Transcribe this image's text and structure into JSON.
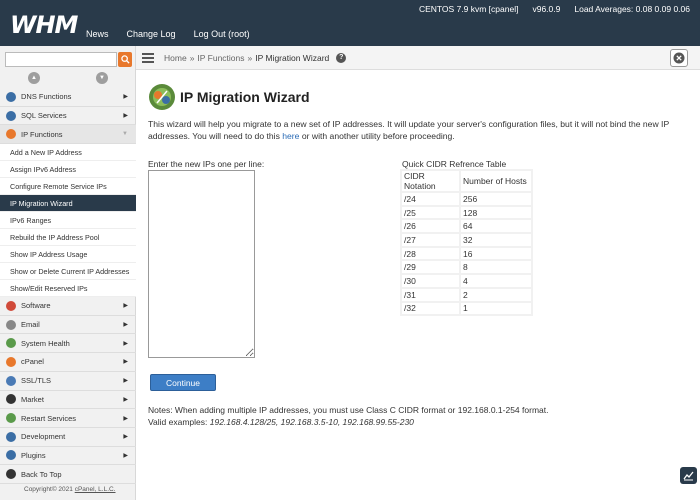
{
  "app": {
    "logo": "WHM"
  },
  "topnav": {
    "items": [
      "News",
      "Change Log",
      "Log Out (root)"
    ]
  },
  "sysinfo": {
    "os": "CENTOS 7.9 kvm [cpanel]",
    "version": "v96.0.9",
    "load": "Load Averages: 0.08 0.09 0.06"
  },
  "search": {
    "value": "",
    "placeholder": ""
  },
  "sidebar": {
    "categories_top": [
      {
        "label": "DNS Functions",
        "icon_color": "#3b6ea5"
      },
      {
        "label": "SQL Services",
        "icon_color": "#3b6ea5"
      },
      {
        "label": "IP Functions",
        "icon_color": "#e8782c"
      }
    ],
    "sub_items": [
      "Add a New IP Address",
      "Assign IPv6 Address",
      "Configure Remote Service IPs",
      "IP Migration Wizard",
      "IPv6 Ranges",
      "Rebuild the IP Address Pool",
      "Show IP Address Usage",
      "Show or Delete Current IP Addresses",
      "Show/Edit Reserved IPs"
    ],
    "active_sub": "IP Migration Wizard",
    "categories_bottom": [
      {
        "label": "Software",
        "icon_color": "#d04a3a"
      },
      {
        "label": "Email",
        "icon_color": "#888888"
      },
      {
        "label": "System Health",
        "icon_color": "#5a9a4a"
      },
      {
        "label": "cPanel",
        "icon_color": "#e8782c"
      },
      {
        "label": "SSL/TLS",
        "icon_color": "#4a7ab5"
      },
      {
        "label": "Market",
        "icon_color": "#333333"
      },
      {
        "label": "Restart Services",
        "icon_color": "#5a9a4a"
      },
      {
        "label": "Development",
        "icon_color": "#3b6ea5"
      },
      {
        "label": "Plugins",
        "icon_color": "#3b6ea5"
      },
      {
        "label": "Back To Top",
        "icon_color": "#333333"
      }
    ],
    "copyright_prefix": "Copyright© 2021 ",
    "copyright_link": "cPanel, L.L.C."
  },
  "breadcrumb": {
    "home": "Home",
    "sep": "»",
    "section": "IP Functions",
    "current": "IP Migration Wizard"
  },
  "main": {
    "title": "IP Migration Wizard",
    "intro_before": "This wizard will help you migrate to a new set of IP addresses. It will update your server's configuration files, but it will not bind the new IP addresses. You will need to do this ",
    "intro_link": "here",
    "intro_after": " or with another utility before proceeding.",
    "ips_label": "Enter the new IPs one per line:",
    "ips_value": "",
    "continue_label": "Continue",
    "notes_line1": "Notes: When adding multiple IP addresses, you must use Class C CIDR format or 192.168.0.1-254 format.",
    "valid_prefix": "Valid examples: ",
    "valid_examples": "192.168.4.128/25, 192.168.3.5-10, 192.168.99.55-230"
  },
  "cidr": {
    "title": "Quick CIDR Refrence Table",
    "headers": [
      "CIDR Notation",
      "Number of Hosts"
    ],
    "rows": [
      [
        "/24",
        "256"
      ],
      [
        "/25",
        "128"
      ],
      [
        "/26",
        "64"
      ],
      [
        "/27",
        "32"
      ],
      [
        "/28",
        "16"
      ],
      [
        "/29",
        "8"
      ],
      [
        "/30",
        "4"
      ],
      [
        "/31",
        "2"
      ],
      [
        "/32",
        "1"
      ]
    ]
  },
  "colors": {
    "topbar": "#293a4a",
    "accent": "#e8782c",
    "button": "#3d7ec6",
    "active_item": "#293a4a"
  }
}
